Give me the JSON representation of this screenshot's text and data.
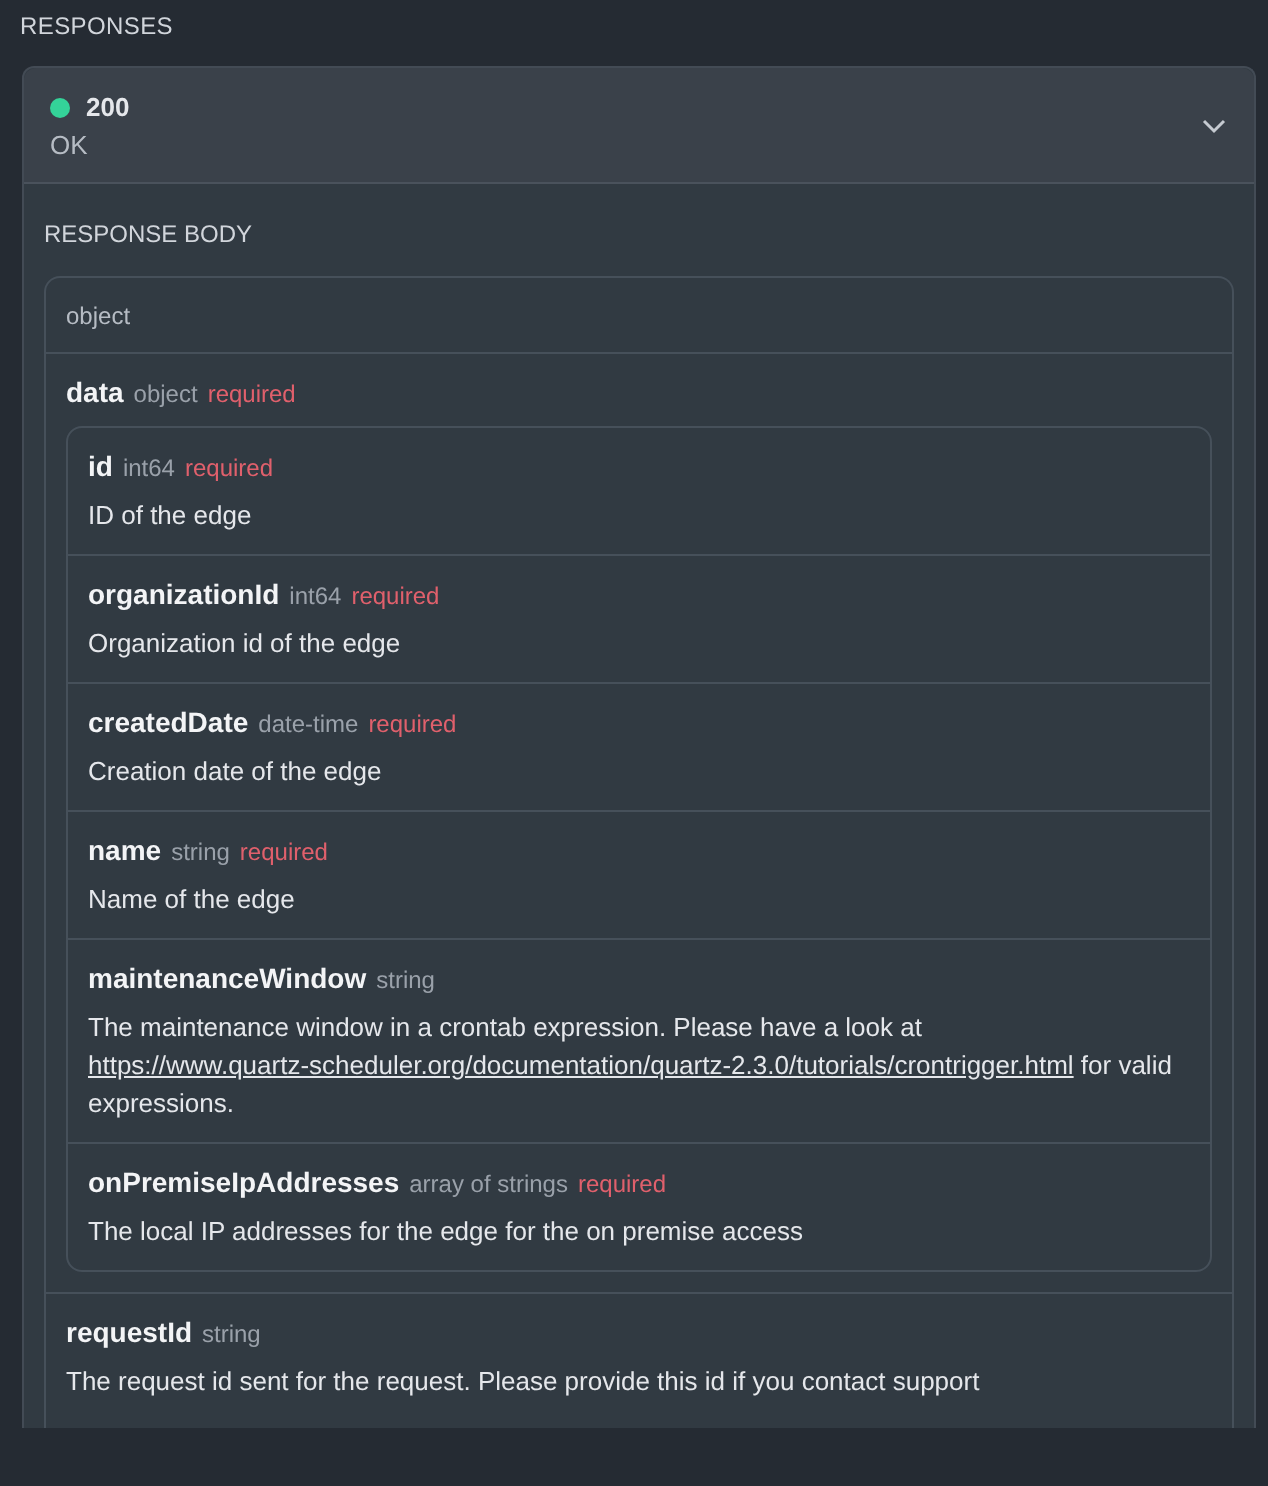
{
  "section_title": "RESPONSES",
  "response": {
    "color": "#34d399",
    "code": "200",
    "message": "OK",
    "expanded": true
  },
  "body_title": "RESPONSE BODY",
  "schema": {
    "type": "object",
    "fields": [
      {
        "name": "data",
        "type": "object",
        "required_label": "required",
        "children": [
          {
            "name": "id",
            "type": "int64",
            "required_label": "required",
            "description": {
              "text": "ID of the edge"
            }
          },
          {
            "name": "organizationId",
            "type": "int64",
            "required_label": "required",
            "description": {
              "text": "Organization id of the edge"
            }
          },
          {
            "name": "createdDate",
            "type": "date-time",
            "required_label": "required",
            "description": {
              "text": "Creation date of the edge"
            }
          },
          {
            "name": "name",
            "type": "string",
            "required_label": "required",
            "description": {
              "text": "Name of the edge"
            }
          },
          {
            "name": "maintenanceWindow",
            "type": "string",
            "description": {
              "text": "The maintenance window in a crontab expression. Please have a look at",
              "link": "https://www.quartz-scheduler.org/documentation/quartz-2.3.0/tutorials/crontrigger.html",
              "text_after": "for valid expressions."
            }
          },
          {
            "name": "onPremiseIpAddresses",
            "type": "array of strings",
            "required_label": "required",
            "description": {
              "text": "The local IP addresses for the edge for the on premise access"
            }
          }
        ]
      },
      {
        "name": "requestId",
        "type": "string",
        "description": {
          "text": "The request id sent for the request. Please provide this id if you contact support"
        }
      }
    ]
  }
}
